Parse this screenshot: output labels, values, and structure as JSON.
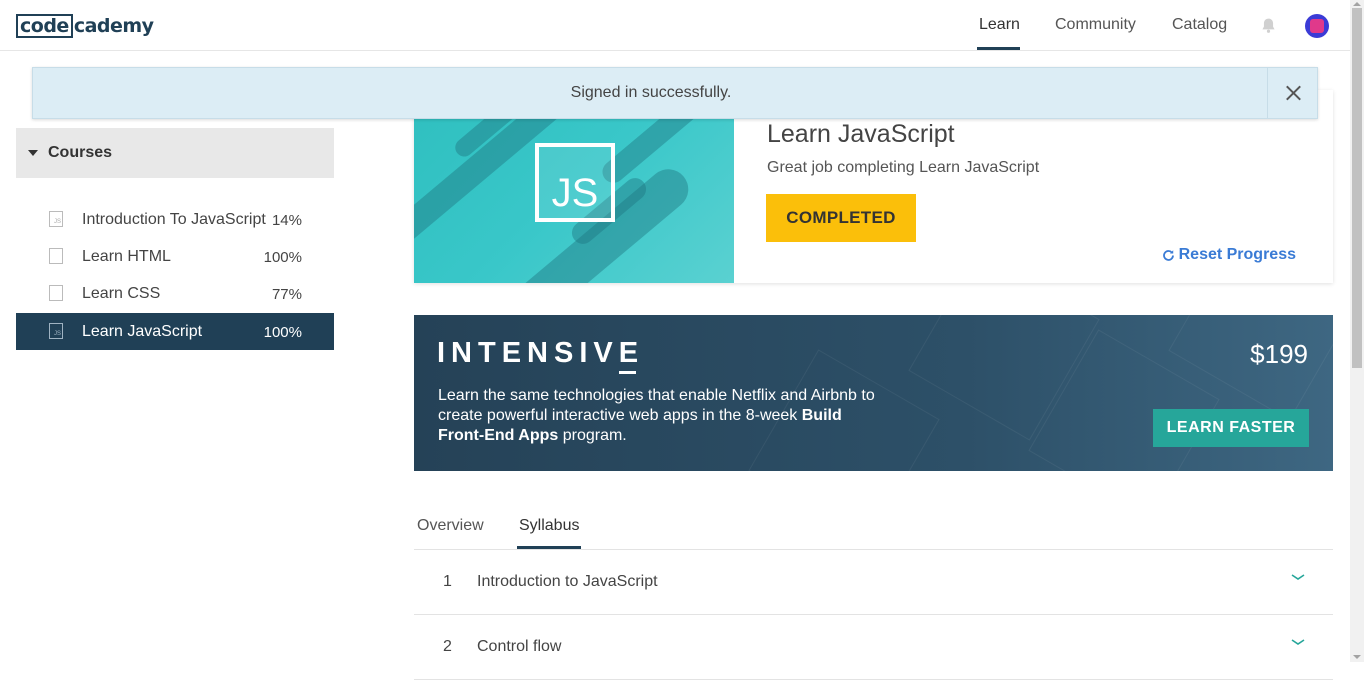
{
  "nav": {
    "logo_boxed": "code",
    "logo_rest": "cademy",
    "links": [
      {
        "label": "Learn",
        "active": true
      },
      {
        "label": "Community",
        "active": false
      },
      {
        "label": "Catalog",
        "active": false
      }
    ],
    "accent": "#204056"
  },
  "flash": {
    "message": "Signed in successfully."
  },
  "sidebar": {
    "header": "Courses",
    "items": [
      {
        "title": "Introduction To JavaScript",
        "percent": "14%",
        "icon": "js-file-icon",
        "active": false
      },
      {
        "title": "Learn HTML",
        "percent": "100%",
        "icon": "html-file-icon",
        "active": false
      },
      {
        "title": "Learn CSS",
        "percent": "77%",
        "icon": "css-file-icon",
        "active": false
      },
      {
        "title": "Learn JavaScript",
        "percent": "100%",
        "icon": "js-file-icon",
        "active": true
      }
    ]
  },
  "course": {
    "badge": "JS",
    "title": "Learn JavaScript",
    "subtitle": "Great job completing Learn JavaScript",
    "status_label": "COMPLETED",
    "reset_label": "Reset Progress",
    "status_color": "#fbbf0a"
  },
  "intensive": {
    "brand": "INTENSIVE",
    "desc_1": "Learn the same technologies that enable Netflix and Airbnb to create powerful interactive web apps in the 8-week ",
    "desc_bold": "Build Front-End Apps",
    "desc_2": " program.",
    "price": "$199",
    "cta": "LEARN FASTER",
    "cta_color": "#26a69a"
  },
  "tabs": [
    {
      "label": "Overview",
      "active": false
    },
    {
      "label": "Syllabus",
      "active": true
    }
  ],
  "syllabus": [
    {
      "num": "1",
      "title": "Introduction to JavaScript"
    },
    {
      "num": "2",
      "title": "Control flow"
    }
  ]
}
